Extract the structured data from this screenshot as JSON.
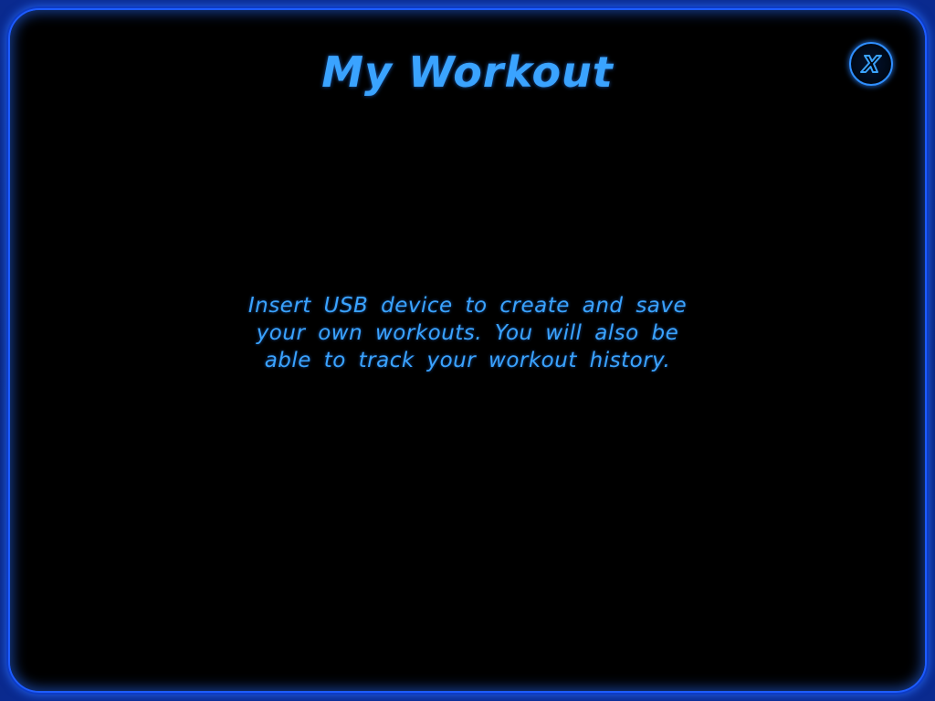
{
  "screen": {
    "title": "My Workout",
    "message": "Insert USB device to create and save your own workouts.  You will also be able to track your workout history."
  },
  "close_button": {
    "icon": "close-x-icon",
    "label": "X"
  },
  "colors": {
    "background": "#000000",
    "accent": "#3aa3ff",
    "frame": "#1d5cff"
  }
}
